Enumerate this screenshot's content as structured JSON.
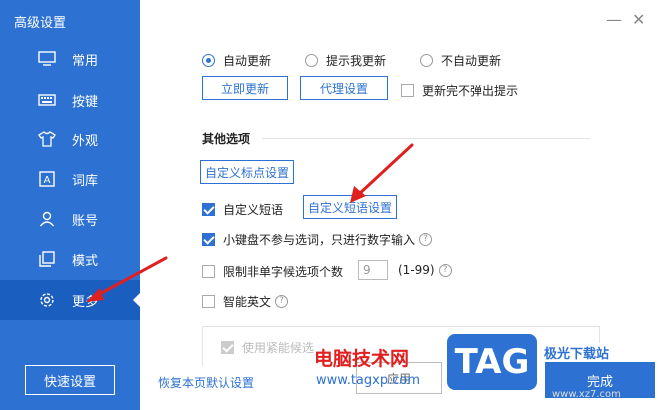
{
  "window": {
    "title": "高级设置",
    "minimize_glyph": "—",
    "close_glyph": "✕"
  },
  "sidebar": {
    "items": [
      {
        "label": "常用",
        "icon": "monitor-icon"
      },
      {
        "label": "按键",
        "icon": "keyboard-icon"
      },
      {
        "label": "外观",
        "icon": "shirt-icon"
      },
      {
        "label": "词库",
        "icon": "dictionary-icon"
      },
      {
        "label": "账号",
        "icon": "user-icon"
      },
      {
        "label": "模式",
        "icon": "mode-icon"
      },
      {
        "label": "更多",
        "icon": "gear-icon",
        "active": true
      }
    ],
    "quick_settings_label": "快速设置"
  },
  "update": {
    "options": [
      "自动更新",
      "提示我更新",
      "不自动更新"
    ],
    "selected": "自动更新",
    "update_now_label": "立即更新",
    "proxy_label": "代理设置",
    "no_popup_label": "更新完不弹出提示"
  },
  "other": {
    "title": "其他选项",
    "custom_punct_label": "自定义标点设置",
    "custom_phrase_label": "自定义短语",
    "custom_phrase_settings_label": "自定义短语设置",
    "keypad_label": "小键盘不参与选词，只进行数字输入",
    "limit_label": "限制非单字候选项个数",
    "limit_value": "9",
    "limit_range": "(1-99)",
    "smart_english_label": "智能英文",
    "help_glyph": "?",
    "faded_option_label": "使用紧能候选"
  },
  "footer": {
    "restore_label": "恢复本页默认设置",
    "apply_label": "应用",
    "done_label": "完成"
  },
  "watermark": {
    "site_name": "电脑技术网",
    "url": "www.tagxp.com",
    "logo": "TAG",
    "side_text": "极光下载站",
    "side_url": "www.xz7.com"
  },
  "colors": {
    "accent": "#2d72d2",
    "arrow": "#e02020"
  }
}
